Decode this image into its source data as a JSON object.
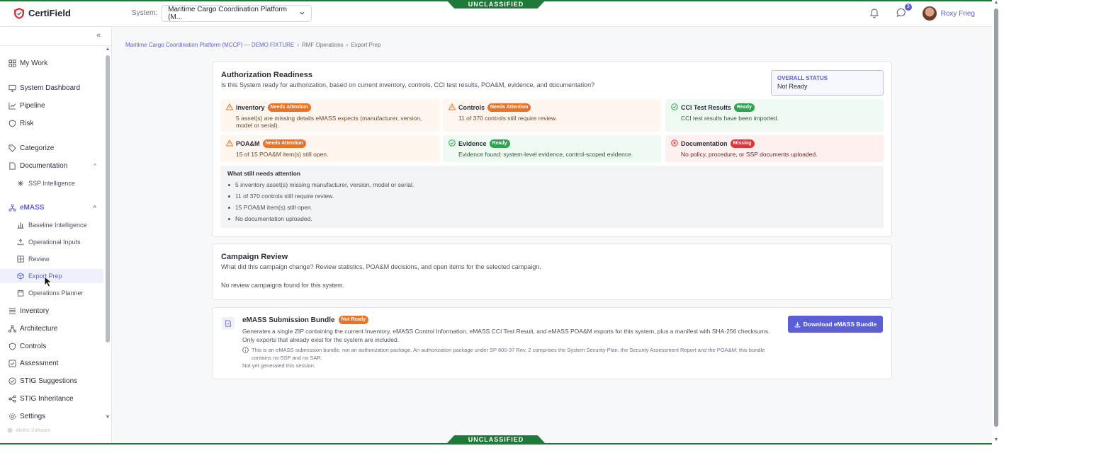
{
  "banner": {
    "top": "UNCLASSIFIED",
    "bottom": "UNCLASSIFIED"
  },
  "header": {
    "app_name": "CertiField",
    "system_label": "System:",
    "system_value": "Maritime Cargo Coordination Platform (M...",
    "notifications_icon": "bell-icon",
    "messages_icon": "chat-icon",
    "messages_count": "3",
    "user_name": "Roxy Frieg"
  },
  "sidebar": {
    "collapse_icon": "double-chevron-left-icon",
    "items": [
      {
        "label": "My Work",
        "icon": "grid-icon"
      },
      {
        "label": "System Dashboard",
        "icon": "monitor-icon"
      },
      {
        "label": "Pipeline",
        "icon": "trend-icon"
      },
      {
        "label": "Risk",
        "icon": "shield-icon"
      },
      {
        "label": "Categorize",
        "icon": "tag-icon"
      },
      {
        "label": "Documentation",
        "icon": "document-icon"
      },
      {
        "label": "SSP Intelligence",
        "icon": "sparkle-icon"
      },
      {
        "label": "eMASS",
        "icon": "network-icon"
      },
      {
        "label": "Baseline Intelligence",
        "icon": "bar-chart-icon"
      },
      {
        "label": "Operational Inputs",
        "icon": "upload-icon"
      },
      {
        "label": "Review",
        "icon": "table-icon"
      },
      {
        "label": "Export Prep",
        "icon": "box-icon"
      },
      {
        "label": "Operations Planner",
        "icon": "calendar-icon"
      },
      {
        "label": "Inventory",
        "icon": "list-icon"
      },
      {
        "label": "Architecture",
        "icon": "hierarchy-icon"
      },
      {
        "label": "Controls",
        "icon": "shield-icon"
      },
      {
        "label": "Assessment",
        "icon": "checkbox-icon"
      },
      {
        "label": "STIG Suggestions",
        "icon": "check-circle-icon"
      },
      {
        "label": "STIG Inheritance",
        "icon": "share-icon"
      },
      {
        "label": "Settings",
        "icon": "gear-icon"
      }
    ],
    "footer": "Aletho Software"
  },
  "breadcrumb": {
    "system": "Maritime Cargo Coordination Platform (MCCP) — DEMO FIXTURE",
    "section": "RMF Operations",
    "page": "Export Prep"
  },
  "readiness": {
    "title": "Authorization Readiness",
    "subtitle": "Is this System ready for authorization, based on current inventory, controls, CCI test results, POA&M, evidence, and documentation?",
    "overall_label": "OVERALL STATUS",
    "overall_value": "Not Ready",
    "tiles": [
      {
        "name": "Inventory",
        "status": "Needs Attention",
        "desc": "5 asset(s) are missing details eMASS expects (manufacturer, version, model or serial)."
      },
      {
        "name": "Controls",
        "status": "Needs Attention",
        "desc": "11 of 370 controls still require review."
      },
      {
        "name": "CCI Test Results",
        "status": "Ready",
        "desc": "CCI test results have been imported."
      },
      {
        "name": "POA&M",
        "status": "Needs Attention",
        "desc": "15 of 15 POA&M item(s) still open."
      },
      {
        "name": "Evidence",
        "status": "Ready",
        "desc": "Evidence found: system-level evidence, control-scoped evidence."
      },
      {
        "name": "Documentation",
        "status": "Missing",
        "desc": "No policy, procedure, or SSP documents uploaded."
      }
    ],
    "attention_title": "What still needs attention",
    "attention_items": [
      "5 inventory asset(s) missing manufacturer, version, model or serial.",
      "11 of 370 controls still require review.",
      "15 POA&M item(s) still open.",
      "No documentation uploaded."
    ]
  },
  "campaign": {
    "title": "Campaign Review",
    "subtitle": "What did this campaign change? Review statistics, POA&M decisions, and open items for the selected campaign.",
    "empty": "No review campaigns found for this system."
  },
  "bundle": {
    "title": "eMASS Submission Bundle",
    "status": "Not Ready",
    "desc_line1": "Generates a single ZIP containing the current Inventory, eMASS Control Information, eMASS CCI Test Result, and eMASS POA&M exports for this system, plus a manifest with SHA-256 checksums.",
    "desc_line2": "Only exports that already exist for the system are included.",
    "note": "This is an eMASS submission bundle, not an authorization package. An authorization package under SP 800-37 Rev. 2 comprises the System Security Plan, the Security Assessment Report and the POA&M; this bundle contains no SSP and no SAR.",
    "generated": "Not yet generated this session.",
    "button": "Download eMASS Bundle"
  },
  "colors": {
    "accent": "#5b5fd6",
    "banner": "#1f7a3a",
    "warn": "#e8742a",
    "ok": "#2ea44f",
    "bad": "#d9363e"
  }
}
